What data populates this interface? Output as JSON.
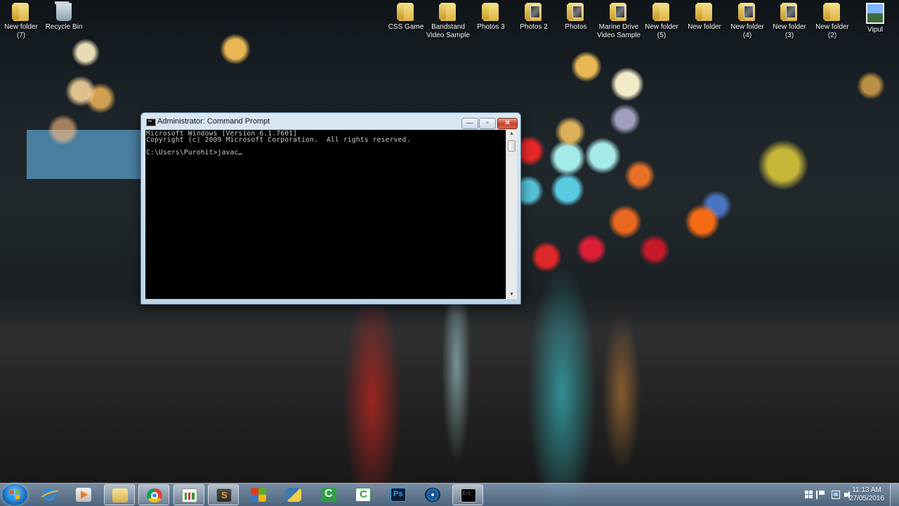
{
  "desktop": {
    "icons": [
      {
        "label": "New folder\n(7)",
        "icon": "folder-icon"
      },
      {
        "label": "Recycle Bin",
        "icon": "recycle-bin-icon"
      },
      {
        "label": "CSS Game",
        "icon": "folder-icon"
      },
      {
        "label": "Bandstand\nVideo Sample",
        "icon": "folder-icon"
      },
      {
        "label": "Photos 3",
        "icon": "folder-icon"
      },
      {
        "label": "Photos 2",
        "icon": "photo-folder-icon"
      },
      {
        "label": "Photos",
        "icon": "photo-folder-icon"
      },
      {
        "label": "Marine Drive\nVideo Sample",
        "icon": "photo-folder-icon"
      },
      {
        "label": "New folder\n(5)",
        "icon": "folder-icon"
      },
      {
        "label": "New folder",
        "icon": "folder-icon"
      },
      {
        "label": "New folder\n(4)",
        "icon": "photo-folder-icon"
      },
      {
        "label": "New folder\n(3)",
        "icon": "photo-folder-icon"
      },
      {
        "label": "New folder\n(2)",
        "icon": "folder-icon"
      },
      {
        "label": "Vipul",
        "icon": "image-file-icon"
      }
    ]
  },
  "window": {
    "title": "Administrator: Command Prompt",
    "controls": {
      "minimize": "—",
      "maximize": "▫",
      "close": "✕"
    },
    "console": {
      "lines": [
        "Microsoft Windows [Version 6.1.7601]",
        "Copyright (c) 2009 Microsoft Corporation.  All rights reserved.",
        "",
        "C:\\Users\\Purohit>javac"
      ]
    },
    "scrollbar": {
      "up": "▲",
      "down": "▼"
    }
  },
  "taskbar": {
    "pinned": [
      {
        "name": "internet-explorer-icon",
        "active": false
      },
      {
        "name": "media-player-icon",
        "active": false
      },
      {
        "name": "file-explorer-icon",
        "active": false
      },
      {
        "name": "chrome-icon",
        "active": false
      },
      {
        "name": "chart-app-icon",
        "active": false
      },
      {
        "name": "sublime-text-icon",
        "active": false
      },
      {
        "name": "office-icon",
        "active": false
      },
      {
        "name": "python-icon",
        "active": false
      },
      {
        "name": "camtasia-recorder-icon",
        "active": false
      },
      {
        "name": "camtasia-studio-icon",
        "active": false
      },
      {
        "name": "photoshop-icon",
        "active": false
      },
      {
        "name": "disc-burner-icon",
        "active": false
      },
      {
        "name": "command-prompt-icon",
        "active": true
      }
    ],
    "clock": {
      "time": "11:13 AM",
      "date": "27/05/2016"
    }
  }
}
